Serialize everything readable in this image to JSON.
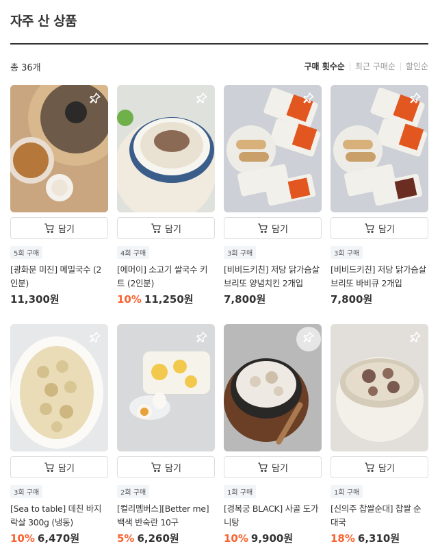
{
  "header": {
    "title": "자주 산 상품"
  },
  "summary": {
    "count": "총 36개"
  },
  "sort": [
    {
      "label": "구매 횟수순",
      "active": true
    },
    {
      "label": "최근 구매순",
      "active": false
    },
    {
      "label": "할인순",
      "active": false
    }
  ],
  "cart_label": "담기",
  "products": [
    {
      "badge": "5회 구매",
      "name": "[광화문 미진] 메밀국수 (2인분)",
      "discount": "",
      "price": "11,300원"
    },
    {
      "badge": "4회 구매",
      "name": "[에머이] 소고기 쌀국수 키트 (2인분)",
      "discount": "10%",
      "price": "11,250원"
    },
    {
      "badge": "3회 구매",
      "name": "[비비드키친] 저당 닭가슴살 브리또 양념치킨 2개입",
      "discount": "",
      "price": "7,800원"
    },
    {
      "badge": "3회 구매",
      "name": "[비비드키친] 저당 닭가슴살 브리또 바비큐 2개입",
      "discount": "",
      "price": "7,800원"
    },
    {
      "badge": "3회 구매",
      "name": "[Sea to table] 데친 바지락살 300g (냉동)",
      "discount": "10%",
      "price": "6,470원"
    },
    {
      "badge": "2회 구매",
      "name": "[컬리멤버스][Better me] 백색 반숙란 10구",
      "discount": "5%",
      "price": "6,260원"
    },
    {
      "badge": "1회 구매",
      "name": "[경복궁 BLACK] 사골 도가니탕",
      "discount": "10%",
      "price": "9,900원"
    },
    {
      "badge": "1회 구매",
      "name": "[신의주 찹쌀순대] 찹쌀 순대국",
      "discount": "18%",
      "price": "6,310원"
    }
  ],
  "colors": {
    "accent": "#fa622f",
    "text": "#333333",
    "badge_bg": "#f2f5f8"
  },
  "icons": {
    "pin": "pin-icon",
    "cart": "cart-icon"
  }
}
